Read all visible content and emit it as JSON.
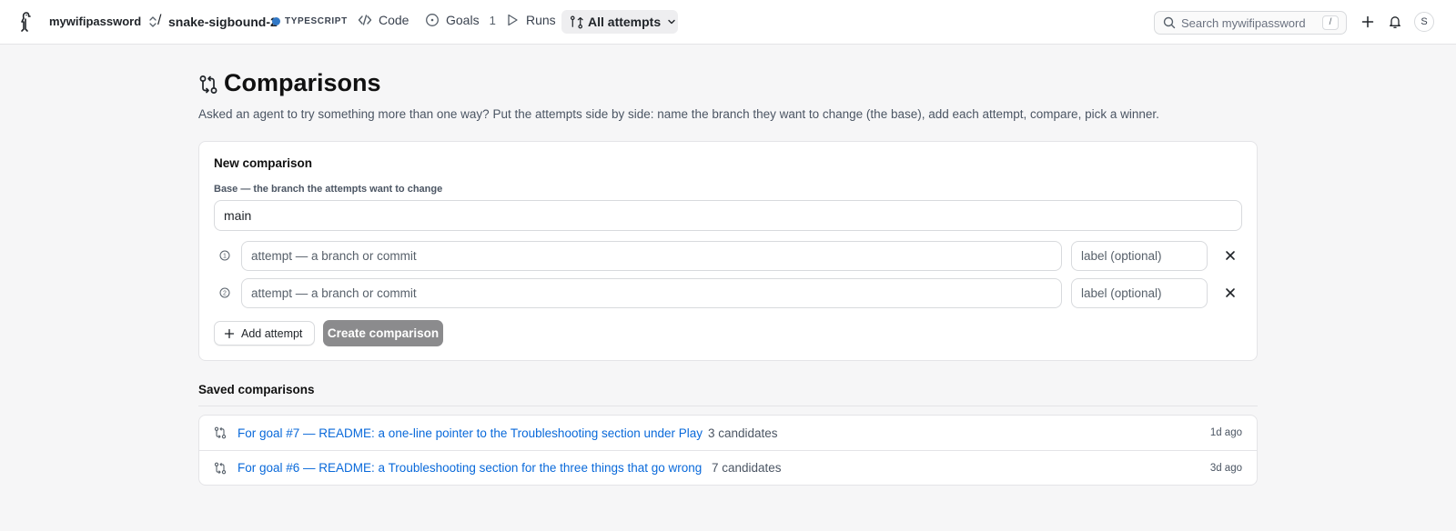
{
  "topbar": {
    "org": "mywifipassword",
    "separator": "/",
    "repo": "snake-sigbound-2",
    "language": "TYPESCRIPT",
    "language_color": "#3178c6",
    "nav": {
      "code": "Code",
      "goals": "Goals",
      "goals_count": "1",
      "runs": "Runs",
      "attempts": "All attempts"
    },
    "search_placeholder": "Search mywifipassword",
    "search_shortcut": "/",
    "avatar_initial": "S"
  },
  "page": {
    "title": "Comparisons",
    "description": "Asked an agent to try something more than one way? Put the attempts side by side: name the branch they want to change (the base), add each attempt, compare, pick a winner."
  },
  "new_comparison": {
    "title": "New comparison",
    "base_label": "Base — the branch the attempts want to change",
    "base_value": "main",
    "attempts": [
      {
        "number": "1",
        "placeholder": "attempt — a branch or commit",
        "label_placeholder": "label (optional)"
      },
      {
        "number": "2",
        "placeholder": "attempt — a branch or commit",
        "label_placeholder": "label (optional)"
      }
    ],
    "add_attempt_label": "Add attempt",
    "create_label": "Create comparison"
  },
  "saved": {
    "title": "Saved comparisons",
    "items": [
      {
        "title": "For goal #7 — README: a one-line pointer to the Troubleshooting section under Play",
        "candidates": "3 candidates",
        "time": "1d ago"
      },
      {
        "title": "For goal #6 — README: a Troubleshooting section for the three things that go wrong",
        "candidates": "7 candidates",
        "time": "3d ago"
      }
    ]
  },
  "icons": {
    "logo": "penguin-logo-icon",
    "compare": "git-compare-icon",
    "close": "close-icon",
    "plus": "plus-icon"
  },
  "colors": {
    "link": "#0969da",
    "create_button": "#8b8b8d"
  }
}
